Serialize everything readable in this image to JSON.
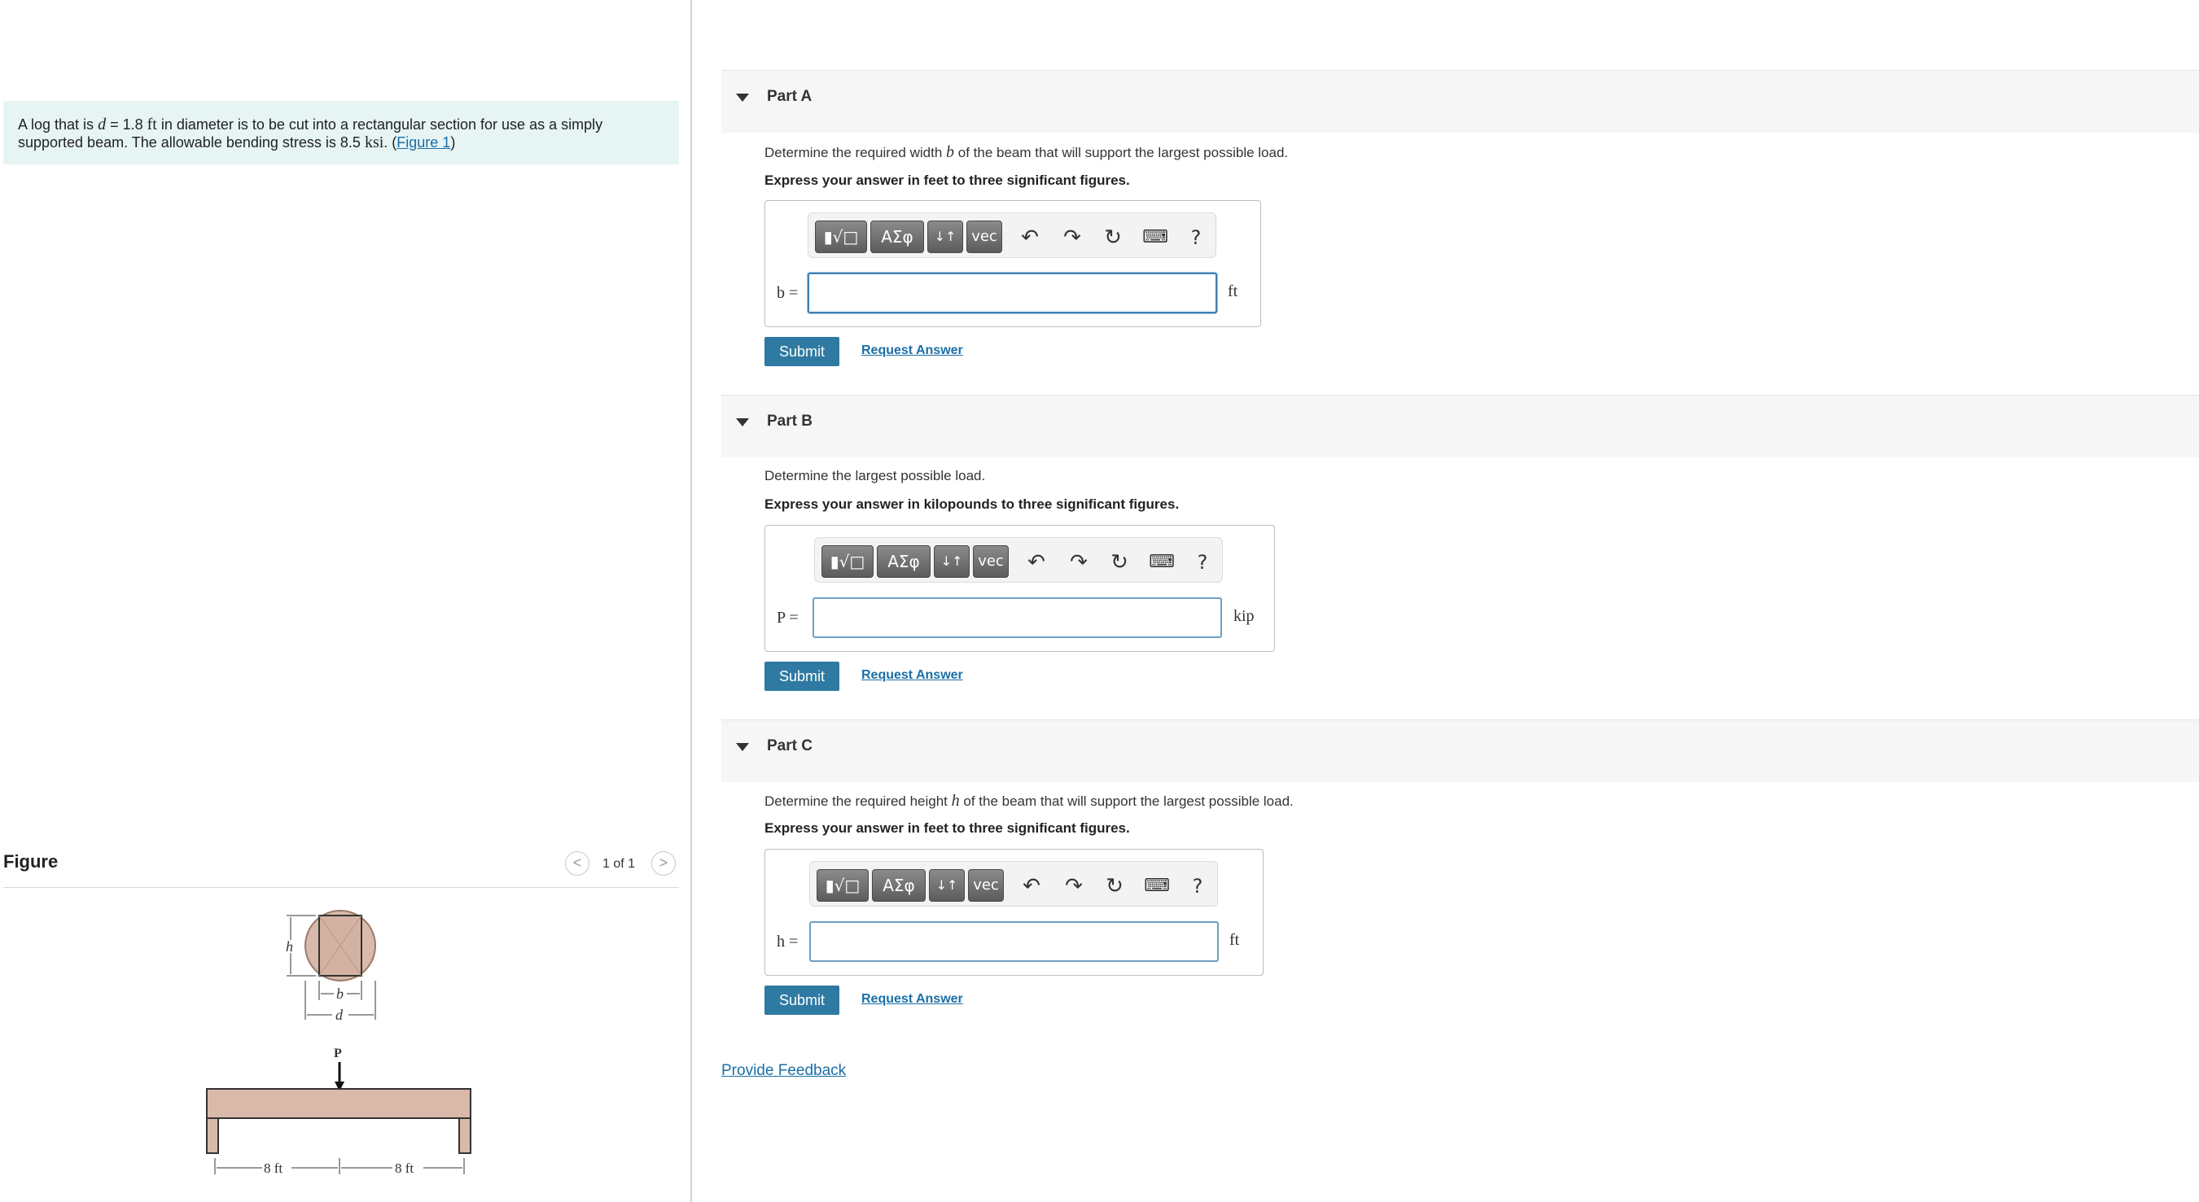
{
  "problem": {
    "text_pre": "A log that is ",
    "var_d": "d",
    "text_eq": " = 1.8 ",
    "unit_ft": "ft",
    "text_mid": " in diameter is to be cut into a rectangular section for use as a simply supported beam. The allowable bending stress is 8.5 ",
    "unit_ksi": "ksi",
    "text_dot": ". (",
    "figure_link": "Figure 1",
    "text_close": ")"
  },
  "figure": {
    "title": "Figure",
    "count": "1 of 1",
    "prev_icon": "chevron-left-icon",
    "next_icon": "chevron-right-icon",
    "prev_glyph": "<",
    "next_glyph": ">",
    "label_h": "h",
    "label_b": "b",
    "label_d": "d",
    "label_P": "P",
    "label_span1": "8 ft",
    "label_span2": "8 ft"
  },
  "toolbar": {
    "templates_label": "▮√□",
    "greek_label": "ΑΣφ",
    "arrows_label": "↓↑",
    "vec_label": "vec",
    "undo_icon": "undo-icon",
    "redo_icon": "redo-icon",
    "reset_icon": "reset-icon",
    "keyboard_icon": "keyboard-icon",
    "help_label": "?",
    "undo_glyph": "↶",
    "redo_glyph": "↷",
    "reset_glyph": "↻",
    "keyboard_glyph": "⌨"
  },
  "parts": [
    {
      "title": "Part A",
      "question_pre": "Determine the required width ",
      "question_var": "b",
      "question_post": " of the beam that will support the largest possible load.",
      "instruction": "Express your answer in feet to three significant figures.",
      "answer_label": "b =",
      "answer_value": "",
      "unit": "ft",
      "submit_label": "Submit",
      "request_label": "Request Answer"
    },
    {
      "title": "Part B",
      "question_pre": "Determine the largest possible load.",
      "question_var": "",
      "question_post": "",
      "instruction": "Express your answer in kilopounds to three significant figures.",
      "answer_label": "P =",
      "answer_value": "",
      "unit": "kip",
      "submit_label": "Submit",
      "request_label": "Request Answer"
    },
    {
      "title": "Part C",
      "question_pre": "Determine the required height ",
      "question_var": "h",
      "question_post": " of the beam that will support the largest possible load.",
      "instruction": "Express your answer in feet to three significant figures.",
      "answer_label": "h =",
      "answer_value": "",
      "unit": "ft",
      "submit_label": "Submit",
      "request_label": "Request Answer"
    }
  ],
  "feedback_link": "Provide Feedback"
}
